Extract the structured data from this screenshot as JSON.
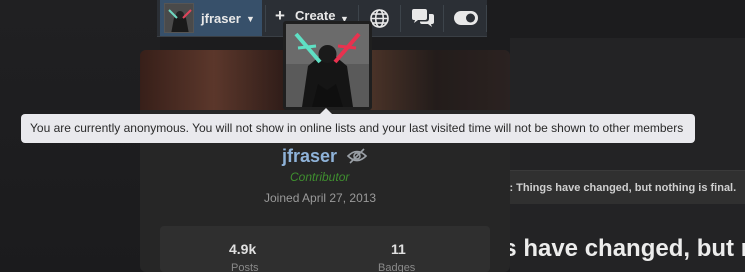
{
  "nav": {
    "username": "jfraser",
    "create_label": "Create",
    "icons": [
      "globe-icon",
      "chat-bubbles-icon",
      "toggle-icon"
    ]
  },
  "tooltip": {
    "text": "You are currently anonymous. You will not show in online lists and your last visited time will not be shown to other members"
  },
  "profile": {
    "name": "jfraser",
    "role": "Contributor",
    "joined": "Joined April 27, 2013",
    "stats": [
      {
        "value": "4.9k",
        "label": "Posts"
      },
      {
        "value": "11",
        "label": "Badges"
      }
    ]
  },
  "background": {
    "notice": "Note: Things have changed, but nothing is final.",
    "headline": "Things have changed, but nothing is final."
  },
  "colors": {
    "name_link": "#8fb3d9",
    "role_green": "#3f8f2f",
    "nav_user_bg": "#37506a",
    "tooltip_bg": "#e9e9ed"
  }
}
